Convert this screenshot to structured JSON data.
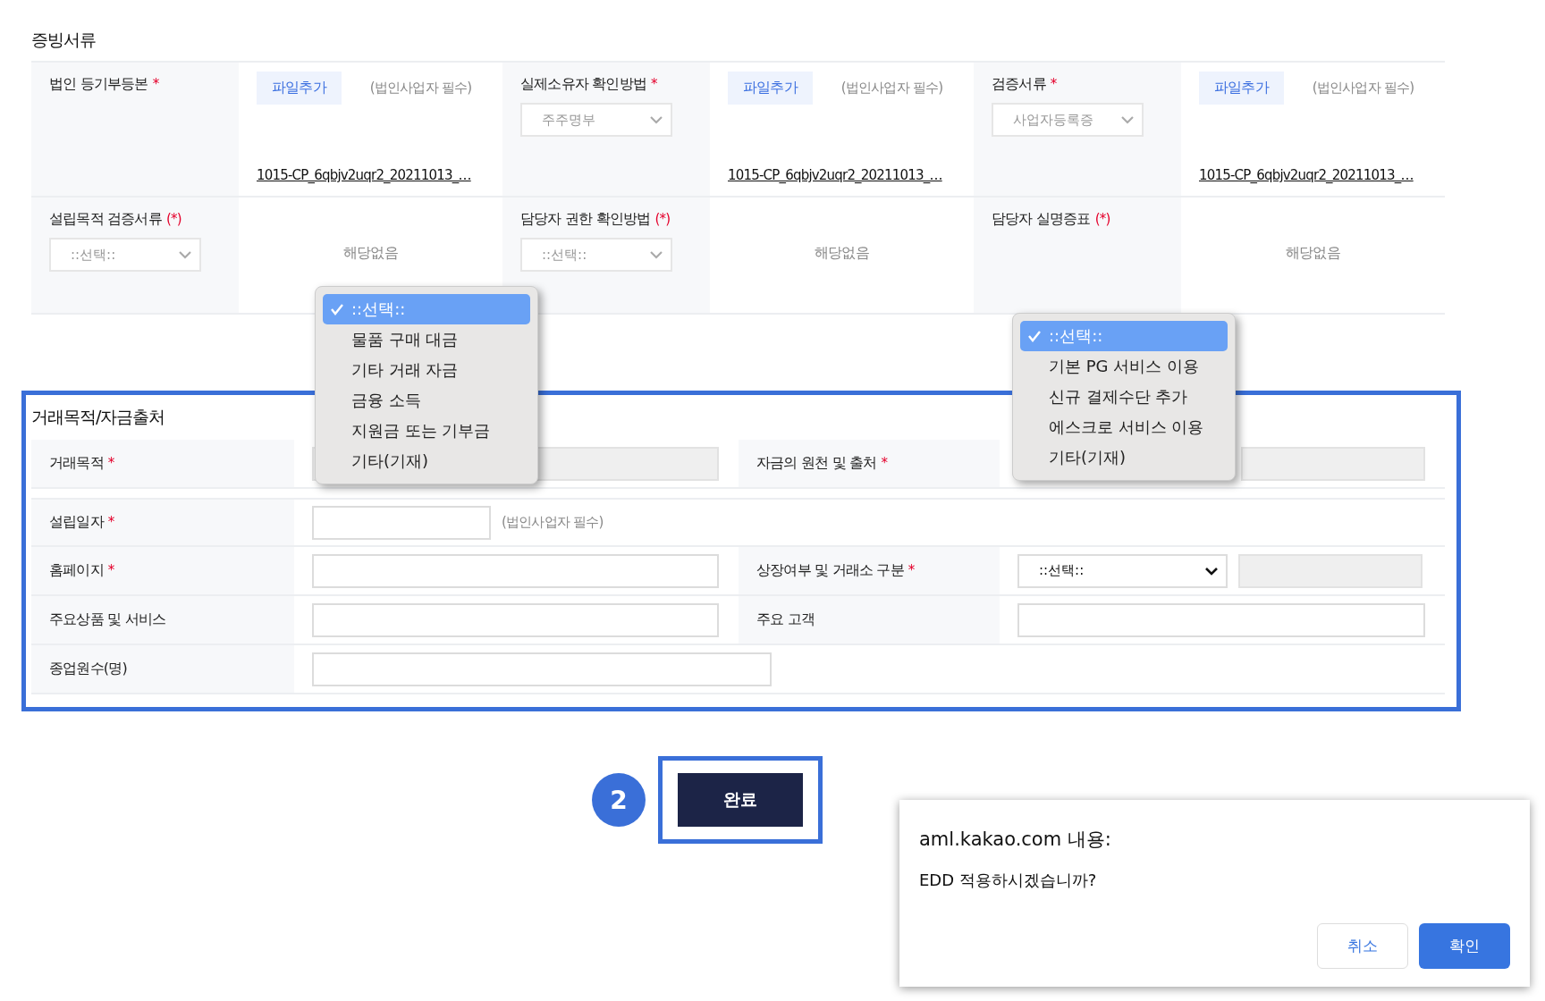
{
  "evidence": {
    "title": "증빙서류",
    "rows": [
      {
        "cells": [
          {
            "label": "법인 등기부등본",
            "mark": "*",
            "value": {
              "kind": "file",
              "button": "파일추가",
              "note": "(법인사업자 필수)",
              "file_name": "1015-CP_6qbjv2uqr2_20211013_…"
            }
          },
          {
            "label": "실제소유자 확인방법",
            "mark": "*",
            "select": {
              "value": "주주명부",
              "disabled": true
            },
            "value": {
              "kind": "file",
              "button": "파일추가",
              "note": "(법인사업자 필수)",
              "file_name": "1015-CP_6qbjv2uqr2_20211013_…"
            }
          },
          {
            "label": "검증서류",
            "mark": "*",
            "select": {
              "value": "사업자등록증",
              "disabled": true
            },
            "value": {
              "kind": "file",
              "button": "파일추가",
              "note": "(법인사업자 필수)",
              "file_name": "1015-CP_6qbjv2uqr2_20211013_…"
            }
          }
        ]
      },
      {
        "cells": [
          {
            "label": "설립목적 검증서류",
            "mark": "(*)",
            "select": {
              "value": "::선택::",
              "disabled": true
            },
            "value": {
              "kind": "none",
              "text": "해당없음"
            }
          },
          {
            "label": "담당자 권한 확인방법",
            "mark": "(*)",
            "select": {
              "value": "::선택::",
              "disabled": true
            },
            "value": {
              "kind": "none",
              "text": "해당없음"
            }
          },
          {
            "label": "담당자 실명증표",
            "mark": "(*)",
            "value": {
              "kind": "none",
              "text": "해당없음"
            }
          }
        ]
      }
    ]
  },
  "transaction": {
    "title": "거래목적/자금출처",
    "rows": [
      {
        "cells": [
          {
            "label": "거래목적",
            "mark": "*",
            "fields": [
              {
                "kind": "input",
                "disabled": true
              }
            ]
          },
          {
            "label": "자금의 원천 및 출처",
            "mark": "*",
            "fields": [
              {
                "kind": "input",
                "disabled": true
              }
            ]
          }
        ]
      },
      {
        "cells": [
          {
            "label": "설립일자",
            "mark": "*",
            "fields": [
              {
                "kind": "input",
                "disabled": false
              },
              {
                "kind": "note",
                "text": "(법인사업자 필수)"
              }
            ]
          }
        ]
      },
      {
        "cells": [
          {
            "label": "홈페이지",
            "mark": "*",
            "fields": [
              {
                "kind": "input",
                "disabled": false
              }
            ]
          },
          {
            "label": "상장여부 및 거래소 구분",
            "mark": "*",
            "fields": [
              {
                "kind": "select",
                "value": "::선택::",
                "disabled": false
              },
              {
                "kind": "input",
                "disabled": true
              }
            ]
          }
        ]
      },
      {
        "cells": [
          {
            "label": "주요상품 및 서비스",
            "fields": [
              {
                "kind": "input",
                "disabled": false
              }
            ]
          },
          {
            "label": "주요 고객",
            "fields": [
              {
                "kind": "input",
                "disabled": false
              }
            ]
          }
        ]
      },
      {
        "cells": [
          {
            "label": "종업원수(명)",
            "fields": [
              {
                "kind": "input",
                "disabled": false
              }
            ]
          }
        ]
      }
    ]
  },
  "open_menus": [
    {
      "options": [
        {
          "label": "::선택::",
          "selected": true
        },
        {
          "label": "물품 구매 대금",
          "selected": false
        },
        {
          "label": "기타 거래 자금",
          "selected": false
        },
        {
          "label": "금융 소득",
          "selected": false
        },
        {
          "label": "지원금 또는 기부금",
          "selected": false
        },
        {
          "label": "기타(기재)",
          "selected": false
        }
      ]
    },
    {
      "options": [
        {
          "label": "::선택::",
          "selected": true
        },
        {
          "label": "기본 PG 서비스 이용",
          "selected": false
        },
        {
          "label": "신규 결제수단 추가",
          "selected": false
        },
        {
          "label": "에스크로 서비스 이용",
          "selected": false
        },
        {
          "label": "기타(기재)",
          "selected": false
        }
      ]
    }
  ],
  "step_badge": "2",
  "submit_button": "완료",
  "dialog": {
    "title": "aml.kakao.com 내용:",
    "message": "EDD 적용하시겠습니까?",
    "buttons": [
      {
        "label": "취소",
        "primary": false
      },
      {
        "label": "확인",
        "primary": true
      }
    ]
  }
}
